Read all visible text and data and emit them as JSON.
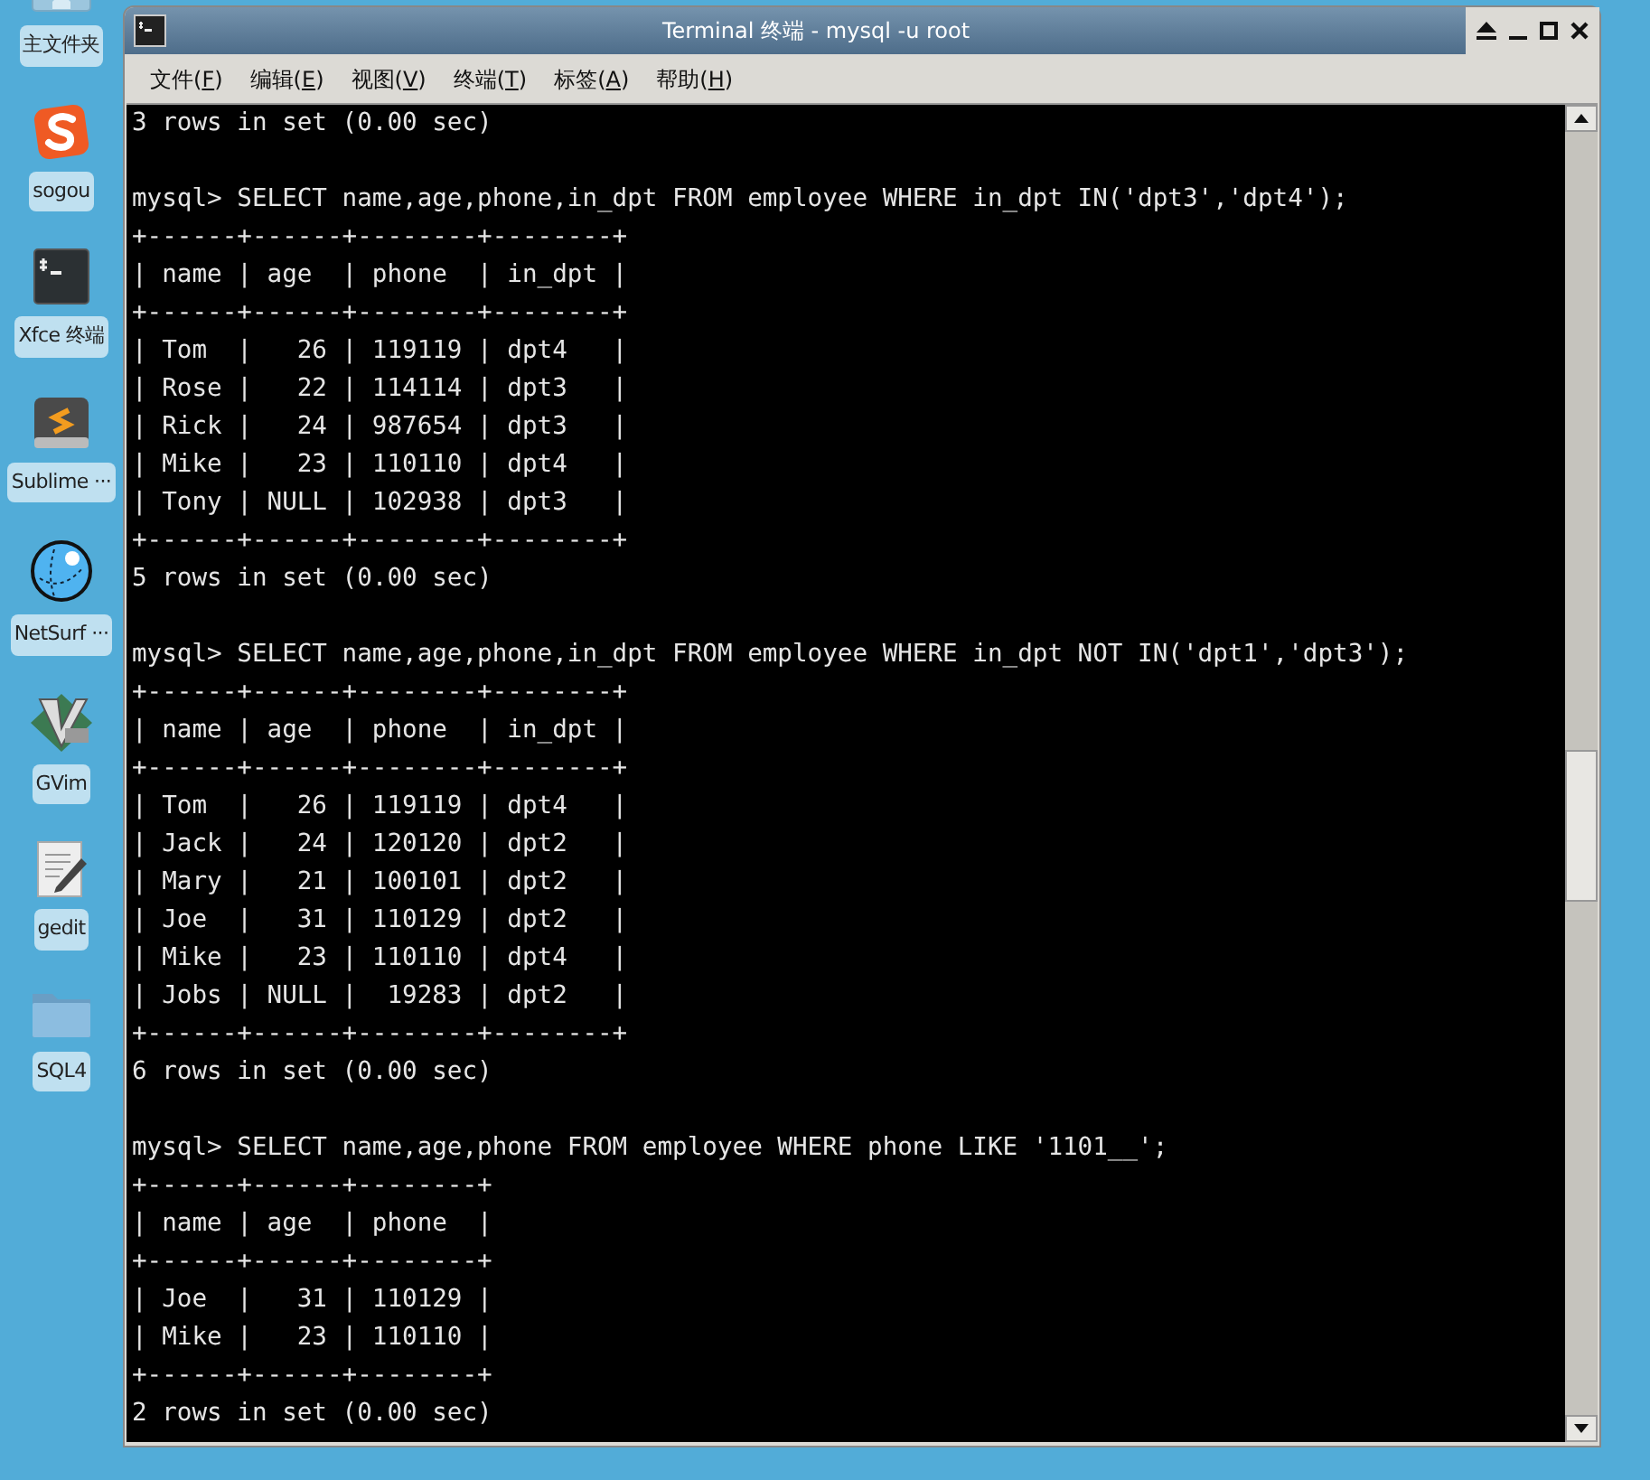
{
  "desktop": {
    "icons": [
      {
        "kind": "home",
        "label": "主文件夹"
      },
      {
        "kind": "sogou",
        "label": "sogou"
      },
      {
        "kind": "terminal",
        "label": "Xfce 终端"
      },
      {
        "kind": "sublime",
        "label": "Sublime ···"
      },
      {
        "kind": "globe",
        "label": "NetSurf ···"
      },
      {
        "kind": "vim",
        "label": "GVim"
      },
      {
        "kind": "editor",
        "label": "gedit"
      },
      {
        "kind": "folder",
        "label": "SQL4"
      }
    ]
  },
  "window": {
    "title": "Terminal 终端 - mysql -u root",
    "menu": [
      {
        "before": "文件(",
        "key": "F",
        "after": ")"
      },
      {
        "before": "编辑(",
        "key": "E",
        "after": ")"
      },
      {
        "before": "视图(",
        "key": "V",
        "after": ")"
      },
      {
        "before": "终端(",
        "key": "T",
        "after": ")"
      },
      {
        "before": "标签(",
        "key": "A",
        "after": ")"
      },
      {
        "before": "帮助(",
        "key": "H",
        "after": ")"
      }
    ],
    "terminal": {
      "blocks": [
        {
          "lines": [
            "3 rows in set (0.00 sec)"
          ]
        },
        {
          "lines": [
            "mysql> SELECT name,age,phone,in_dpt FROM employee WHERE in_dpt IN('dpt3','dpt4');",
            "+------+------+--------+--------+",
            "| name | age  | phone  | in_dpt |",
            "+------+------+--------+--------+",
            "| Tom  |   26 | 119119 | dpt4   |",
            "| Rose |   22 | 114114 | dpt3   |",
            "| Rick |   24 | 987654 | dpt3   |",
            "| Mike |   23 | 110110 | dpt4   |",
            "| Tony | NULL | 102938 | dpt3   |",
            "+------+------+--------+--------+",
            "5 rows in set (0.00 sec)"
          ]
        },
        {
          "lines": [
            "mysql> SELECT name,age,phone,in_dpt FROM employee WHERE in_dpt NOT IN('dpt1','dpt3');",
            "+------+------+--------+--------+",
            "| name | age  | phone  | in_dpt |",
            "+------+------+--------+--------+",
            "| Tom  |   26 | 119119 | dpt4   |",
            "| Jack |   24 | 120120 | dpt2   |",
            "| Mary |   21 | 100101 | dpt2   |",
            "| Joe  |   31 | 110129 | dpt2   |",
            "| Mike |   23 | 110110 | dpt4   |",
            "| Jobs | NULL |  19283 | dpt2   |",
            "+------+------+--------+--------+",
            "6 rows in set (0.00 sec)"
          ]
        },
        {
          "lines": [
            "mysql> SELECT name,age,phone FROM employee WHERE phone LIKE '1101__';",
            "+------+------+--------+",
            "| name | age  | phone  |",
            "+------+------+--------+",
            "| Joe  |   31 | 110129 |",
            "| Mike |   23 | 110110 |",
            "+------+------+--------+",
            "2 rows in set (0.00 sec)"
          ]
        }
      ]
    }
  }
}
